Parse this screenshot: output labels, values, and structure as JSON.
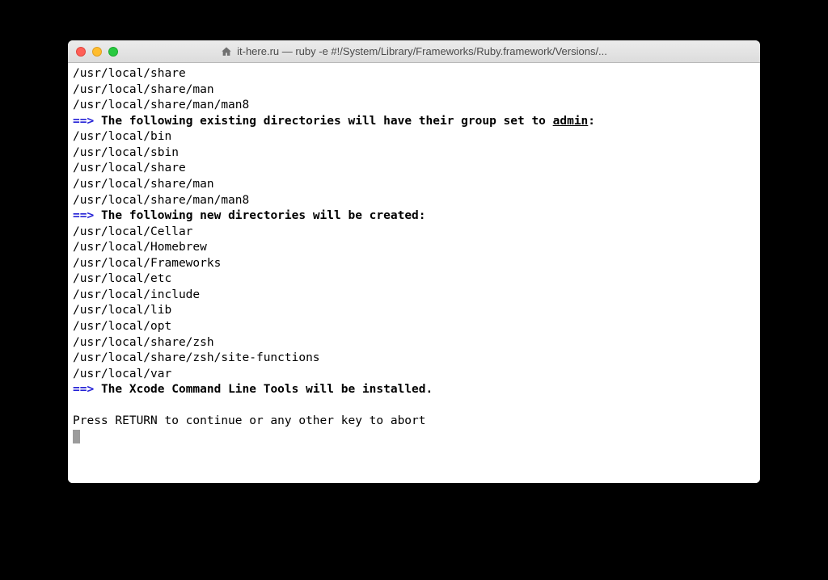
{
  "window": {
    "title": "it-here.ru — ruby -e #!/System/Library/Frameworks/Ruby.framework/Versions/..."
  },
  "content": {
    "existing_dirs_top": [
      "/usr/local/share",
      "/usr/local/share/man",
      "/usr/local/share/man/man8"
    ],
    "arrow": "==>",
    "msg_group_part1": "The following existing directories will have their group set to ",
    "msg_group_admin": "admin",
    "msg_group_colon": ":",
    "group_dirs": [
      "/usr/local/bin",
      "/usr/local/sbin",
      "/usr/local/share",
      "/usr/local/share/man",
      "/usr/local/share/man/man8"
    ],
    "msg_new_dirs": "The following new directories will be created:",
    "new_dirs": [
      "/usr/local/Cellar",
      "/usr/local/Homebrew",
      "/usr/local/Frameworks",
      "/usr/local/etc",
      "/usr/local/include",
      "/usr/local/lib",
      "/usr/local/opt",
      "/usr/local/share/zsh",
      "/usr/local/share/zsh/site-functions",
      "/usr/local/var"
    ],
    "msg_xcode": "The Xcode Command Line Tools will be installed.",
    "prompt": "Press RETURN to continue or any other key to abort"
  }
}
